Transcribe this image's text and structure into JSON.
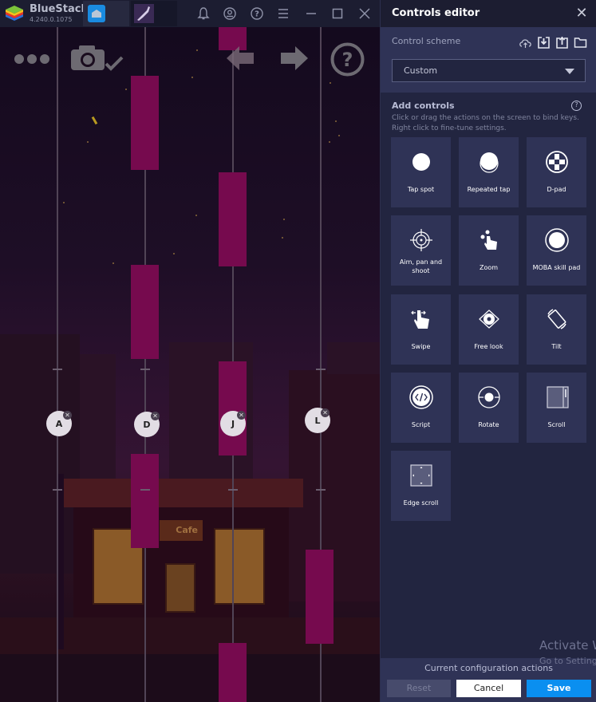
{
  "titlebar": {
    "app_name": "BlueStacks",
    "version": "4.240.0.1075",
    "tabs": [
      {
        "name": "home",
        "icon": "home-icon"
      },
      {
        "name": "game",
        "icon": "game-tab-icon"
      }
    ],
    "buttons": [
      "bell-icon",
      "account-icon",
      "help-icon",
      "menu-icon",
      "minimize-icon",
      "maximize-icon",
      "close-icon"
    ]
  },
  "game": {
    "hud": [
      "more-icon",
      "camera-check-icon",
      "back-arrow-icon",
      "forward-arrow-icon",
      "help-circle-icon"
    ],
    "sign_text": "Cafe",
    "keys": [
      {
        "label": "A"
      },
      {
        "label": "D"
      },
      {
        "label": "J"
      },
      {
        "label": "L"
      }
    ],
    "colors": {
      "tile": "#760a4e",
      "lane": "#514456"
    }
  },
  "panel": {
    "title": "Controls editor",
    "scheme_label": "Control scheme",
    "scheme_icons": [
      "cloud-icon",
      "import-icon",
      "export-icon",
      "folder-icon"
    ],
    "scheme_value": "Custom",
    "add_title": "Add controls",
    "add_desc_1": "Click or drag the actions on the screen to bind keys.",
    "add_desc_2": "Right click to fine-tune settings.",
    "controls": [
      {
        "label": "Tap spot",
        "icon": "tap-spot-icon"
      },
      {
        "label": "Repeated tap",
        "icon": "repeated-tap-icon"
      },
      {
        "label": "D-pad",
        "icon": "dpad-icon"
      },
      {
        "label": "Aim, pan and shoot",
        "icon": "aim-icon"
      },
      {
        "label": "Zoom",
        "icon": "zoom-gesture-icon"
      },
      {
        "label": "MOBA skill pad",
        "icon": "moba-icon"
      },
      {
        "label": "Swipe",
        "icon": "swipe-icon"
      },
      {
        "label": "Free look",
        "icon": "free-look-icon"
      },
      {
        "label": "Tilt",
        "icon": "tilt-icon"
      },
      {
        "label": "Script",
        "icon": "script-icon"
      },
      {
        "label": "Rotate",
        "icon": "rotate-icon"
      },
      {
        "label": "Scroll",
        "icon": "scroll-icon"
      },
      {
        "label": "Edge scroll",
        "icon": "edge-scroll-icon"
      }
    ],
    "footer_label": "Current configuration actions",
    "reset": "Reset",
    "cancel": "Cancel",
    "save": "Save",
    "colors": {
      "accent": "#0a8ff0",
      "card": "#2f3356",
      "panel": "#222540"
    }
  },
  "watermark": {
    "line1": "Activate Windows",
    "line2": "Go to Settings to activate Windows."
  }
}
